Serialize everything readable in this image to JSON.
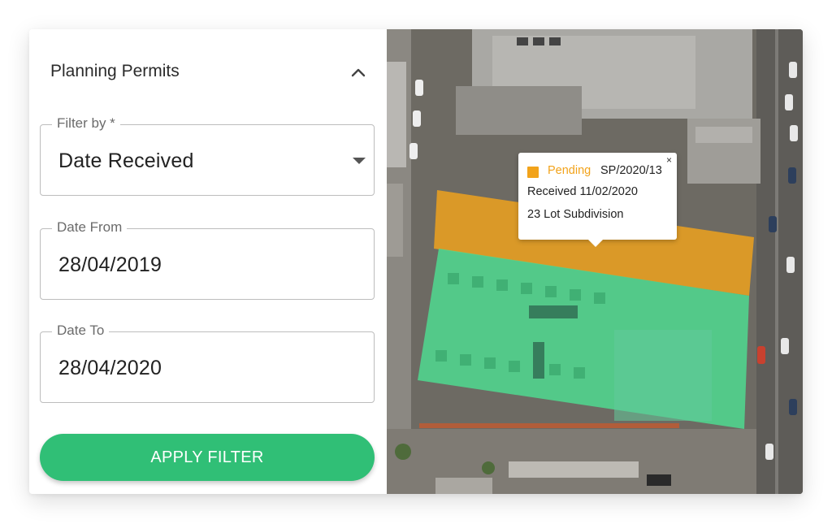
{
  "panel": {
    "title": "Planning Permits",
    "collapse_icon": "chevron-up-icon"
  },
  "filters": {
    "filter_by": {
      "label": "Filter by *",
      "value": "Date Received",
      "icon": "caret-down-icon"
    },
    "date_from": {
      "label": "Date From",
      "value": "28/04/2019"
    },
    "date_to": {
      "label": "Date To",
      "value": "28/04/2020"
    },
    "apply_label": "APPLY FILTER"
  },
  "popup": {
    "status": "Pending",
    "permit_id": "SP/2020/13",
    "received": "Received 11/02/2020",
    "description": "23 Lot Subdivision",
    "close": "×"
  },
  "colors": {
    "accent_green": "#30bf76",
    "pending_orange": "#f2a31b",
    "parcel_green": "#4fd88f"
  }
}
